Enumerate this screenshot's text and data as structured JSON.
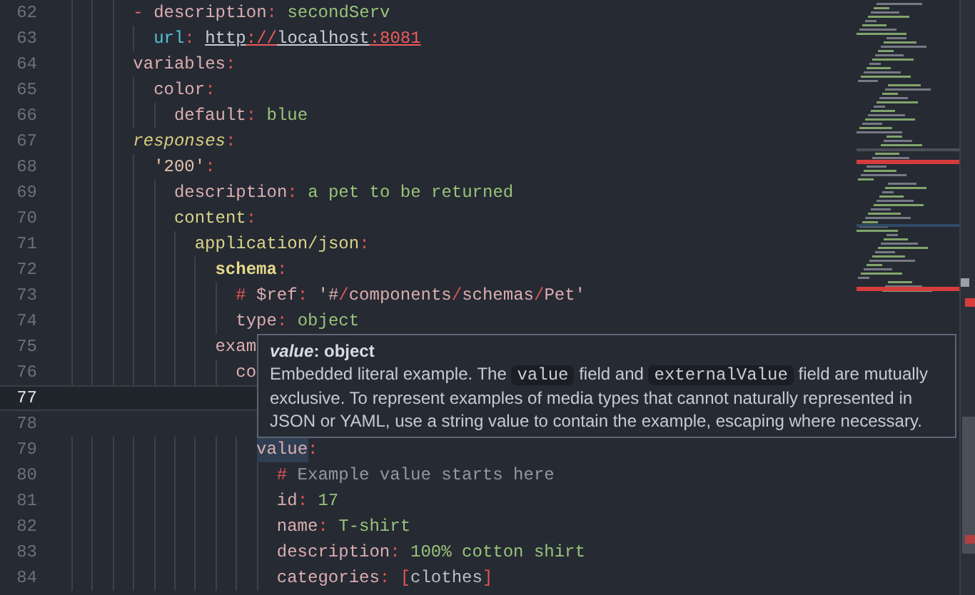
{
  "editor": {
    "lines": [
      {
        "number": "62",
        "current": false,
        "tokens": [
          {
            "kind": "punct",
            "text": "      - "
          },
          {
            "kind": "key",
            "text": "description"
          },
          {
            "kind": "colon",
            "text": ": "
          },
          {
            "kind": "value",
            "text": "secondServ"
          }
        ]
      },
      {
        "number": "63",
        "current": false,
        "tokens": [
          {
            "kind": "urlkey",
            "text": "        url"
          },
          {
            "kind": "colon",
            "text": ": "
          },
          {
            "kind": "link",
            "text": "http"
          },
          {
            "kind": "linkred",
            "text": "://"
          },
          {
            "kind": "link",
            "text": "localhost"
          },
          {
            "kind": "linkred",
            "text": ":8081"
          }
        ]
      },
      {
        "number": "64",
        "current": false,
        "tokens": [
          {
            "kind": "key",
            "text": "      variables"
          },
          {
            "kind": "colon",
            "text": ":"
          }
        ]
      },
      {
        "number": "65",
        "current": false,
        "tokens": [
          {
            "kind": "key",
            "text": "        color"
          },
          {
            "kind": "colon",
            "text": ":"
          }
        ]
      },
      {
        "number": "66",
        "current": false,
        "tokens": [
          {
            "kind": "key",
            "text": "          default"
          },
          {
            "kind": "colon",
            "text": ": "
          },
          {
            "kind": "value",
            "text": "blue"
          }
        ]
      },
      {
        "number": "67",
        "current": false,
        "tokens": [
          {
            "kind": "italickey",
            "text": "      responses"
          },
          {
            "kind": "colon",
            "text": ":"
          }
        ]
      },
      {
        "number": "68",
        "current": false,
        "tokens": [
          {
            "kind": "string",
            "text": "        '200'"
          },
          {
            "kind": "colon",
            "text": ":"
          }
        ]
      },
      {
        "number": "69",
        "current": false,
        "tokens": [
          {
            "kind": "key",
            "text": "          description"
          },
          {
            "kind": "colon",
            "text": ": "
          },
          {
            "kind": "value",
            "text": "a pet to be returned"
          }
        ]
      },
      {
        "number": "70",
        "current": false,
        "tokens": [
          {
            "kind": "yellowkey",
            "text": "          content"
          },
          {
            "kind": "colon",
            "text": ":"
          }
        ]
      },
      {
        "number": "71",
        "current": false,
        "tokens": [
          {
            "kind": "yellowkey",
            "text": "            application/json"
          },
          {
            "kind": "colon",
            "text": ":"
          }
        ]
      },
      {
        "number": "72",
        "current": false,
        "tokens": [
          {
            "kind": "boldkey",
            "text": "              schema"
          },
          {
            "kind": "colon",
            "text": ":"
          }
        ]
      },
      {
        "number": "73",
        "current": false,
        "tokens": [
          {
            "kind": "hash",
            "text": "                #"
          },
          {
            "kind": "key",
            "text": " $ref"
          },
          {
            "kind": "colon",
            "text": ": "
          },
          {
            "kind": "key",
            "text": "'#"
          },
          {
            "kind": "colon",
            "text": "/"
          },
          {
            "kind": "key",
            "text": "components"
          },
          {
            "kind": "colon",
            "text": "/"
          },
          {
            "kind": "key",
            "text": "schemas"
          },
          {
            "kind": "colon",
            "text": "/"
          },
          {
            "kind": "key",
            "text": "Pet'"
          }
        ]
      },
      {
        "number": "74",
        "current": false,
        "tokens": [
          {
            "kind": "key",
            "text": "                type"
          },
          {
            "kind": "colon",
            "text": ": "
          },
          {
            "kind": "value",
            "text": "object"
          }
        ]
      },
      {
        "number": "75",
        "current": false,
        "tokens": [
          {
            "kind": "key",
            "text": "              exam"
          }
        ]
      },
      {
        "number": "76",
        "current": false,
        "tokens": [
          {
            "kind": "key",
            "text": "                co"
          }
        ]
      },
      {
        "number": "77",
        "current": true
      },
      {
        "number": "78",
        "current": false
      },
      {
        "number": "79",
        "current": false,
        "tokens": [
          {
            "kind": "hlkey",
            "text": "                  value"
          },
          {
            "kind": "colon",
            "text": ":"
          }
        ]
      },
      {
        "number": "80",
        "current": false,
        "tokens": [
          {
            "kind": "hash",
            "text": "                    #"
          },
          {
            "kind": "comment",
            "text": " Example value starts here"
          }
        ]
      },
      {
        "number": "81",
        "current": false,
        "tokens": [
          {
            "kind": "key",
            "text": "                    id"
          },
          {
            "kind": "colon",
            "text": ": "
          },
          {
            "kind": "value",
            "text": "17"
          }
        ]
      },
      {
        "number": "82",
        "current": false,
        "tokens": [
          {
            "kind": "key",
            "text": "                    name"
          },
          {
            "kind": "colon",
            "text": ": "
          },
          {
            "kind": "value",
            "text": "T-shirt"
          }
        ]
      },
      {
        "number": "83",
        "current": false,
        "tokens": [
          {
            "kind": "key",
            "text": "                    description"
          },
          {
            "kind": "colon",
            "text": ": "
          },
          {
            "kind": "value",
            "text": "100% cotton shirt"
          }
        ]
      },
      {
        "number": "84",
        "current": false,
        "tokens": [
          {
            "kind": "key",
            "text": "                    categories"
          },
          {
            "kind": "colon",
            "text": ": "
          },
          {
            "kind": "bracket",
            "text": "["
          },
          {
            "kind": "plain",
            "text": "clothes"
          },
          {
            "kind": "bracket",
            "text": "]"
          }
        ]
      }
    ]
  },
  "tooltip": {
    "title": "*value*: object",
    "body": [
      {
        "kind": "text",
        "text": "Embedded literal example. The "
      },
      {
        "kind": "code",
        "text": "value"
      },
      {
        "kind": "text",
        "text": " field and "
      },
      {
        "kind": "code",
        "text": "externalValue"
      },
      {
        "kind": "text",
        "text": " field are mutually exclusive. To represent examples of media types that cannot naturally represented in JSON or YAML, use a string value to contain the example, escaping where necessary."
      }
    ]
  }
}
